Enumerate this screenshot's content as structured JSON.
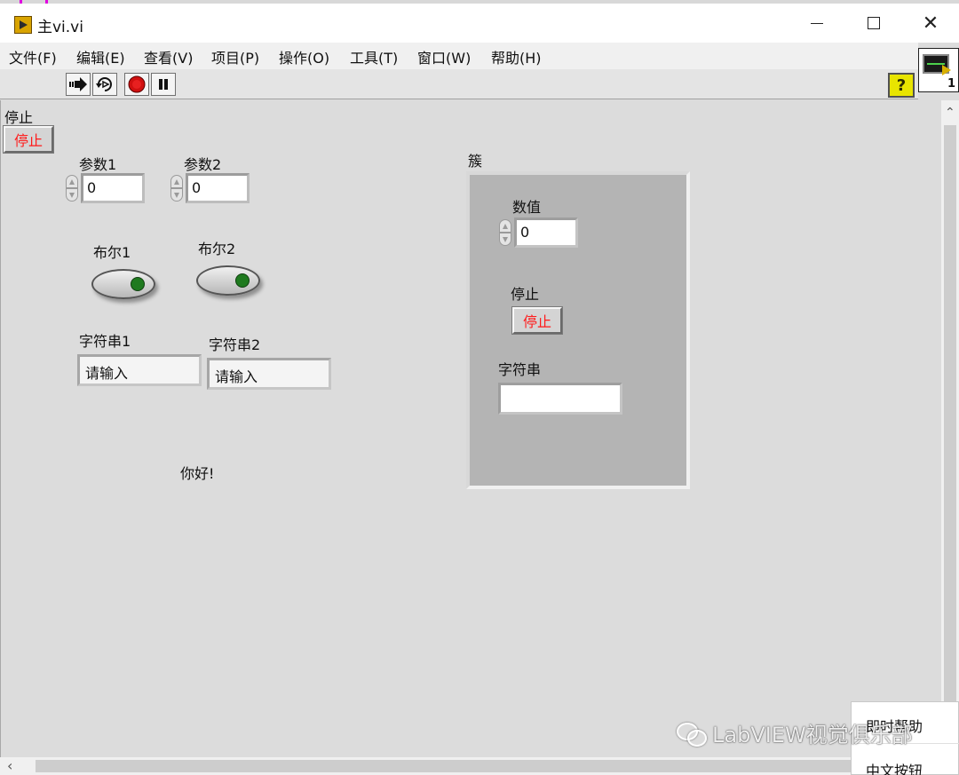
{
  "window": {
    "title": "主vi.vi",
    "controls": [
      "minimize",
      "maximize",
      "close"
    ],
    "close_glyph": "✕"
  },
  "menu": [
    "文件(F)",
    "编辑(E)",
    "查看(V)",
    "项目(P)",
    "操作(O)",
    "工具(T)",
    "窗口(W)",
    "帮助(H)"
  ],
  "toolbar": {
    "icons": [
      "run-arrow-icon",
      "run-continuously-icon",
      "abort-icon",
      "pause-icon"
    ],
    "help_label": "?"
  },
  "vi_icon": {
    "number": "1"
  },
  "panel": {
    "stop_top": {
      "label": "停止",
      "button": "停止"
    },
    "param1": {
      "label": "参数1",
      "value": "0"
    },
    "param2": {
      "label": "参数2",
      "value": "0"
    },
    "bool1": {
      "label": "布尔1"
    },
    "bool2": {
      "label": "布尔2"
    },
    "string1": {
      "label": "字符串1",
      "value": "请输入"
    },
    "string2": {
      "label": "字符串2",
      "value": "请输入"
    },
    "greeting": "你好!",
    "cluster": {
      "label": "簇",
      "numeric": {
        "label": "数值",
        "value": "0"
      },
      "stop": {
        "label": "停止",
        "button": "停止"
      },
      "string": {
        "label": "字符串",
        "value": ""
      }
    }
  },
  "popup_menu": [
    "即时帮助",
    "中文按钮"
  ],
  "watermark": "LabVIEW视觉俱乐部",
  "colors": {
    "stop_text": "#ff1a1a",
    "led_green": "#1f7a1f",
    "cluster_bg": "#b4b4b4",
    "help_yellow": "#e8e400"
  }
}
